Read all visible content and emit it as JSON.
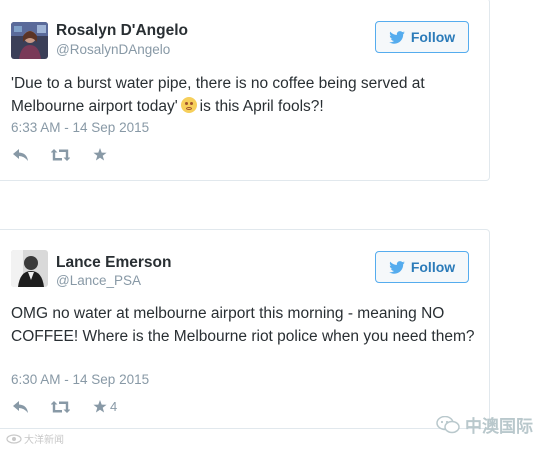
{
  "tweets": [
    {
      "name": "Rosalyn D'Angelo",
      "handle": "@RosalynDAngelo",
      "follow_label": "Follow",
      "text_before_emoji": "'Due to a burst water pipe, there is no coffee being served at Melbourne airport today'",
      "text_after_emoji": "is this April fools?!",
      "timestamp": "6:33 AM - 14 Sep 2015",
      "favorites": ""
    },
    {
      "name": "Lance Emerson",
      "handle": "@Lance_PSA",
      "follow_label": "Follow",
      "text": "OMG no water at melbourne airport this morning - meaning NO COFFEE! Where is the Melbourne riot police when you need them?",
      "timestamp": "6:30 AM - 14 Sep 2015",
      "favorites": "4"
    }
  ],
  "watermarks": {
    "left": "大洋新闻",
    "right": "中澳国际"
  },
  "colors": {
    "twitter_blue": "#55acee",
    "text": "#292f33",
    "muted": "#8899a6",
    "border": "#e1e8ed"
  }
}
